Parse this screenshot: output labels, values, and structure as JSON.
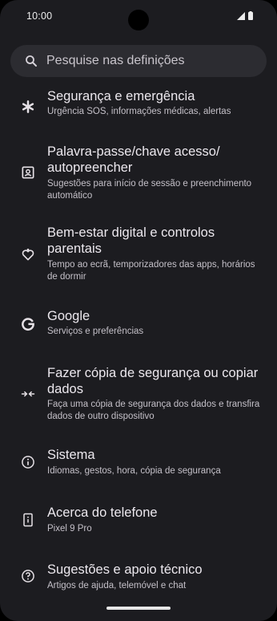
{
  "status_bar": {
    "time": "10:00"
  },
  "search": {
    "placeholder": "Pesquise nas definições"
  },
  "items": [
    {
      "title": "Segurança e emergência",
      "subtitle": "Urgência SOS, informações médicas, alertas",
      "icon": "asterisk-icon"
    },
    {
      "title": "Palavra-passe/chave acesso/ autopreencher",
      "subtitle": "Sugestões para início de sessão e preenchimento automático",
      "icon": "account-box-icon"
    },
    {
      "title": "Bem-estar digital e controlos parentais",
      "subtitle": "Tempo ao ecrã, temporizadores das apps, horários de dormir",
      "icon": "heart-person-icon"
    },
    {
      "title": "Google",
      "subtitle": "Serviços e preferências",
      "icon": "google-icon"
    },
    {
      "title": "Fazer cópia de segurança ou copiar dados",
      "subtitle": "Faça uma cópia de segurança dos dados e transfira dados de outro dispositivo",
      "icon": "transfer-icon"
    },
    {
      "title": "Sistema",
      "subtitle": "Idiomas, gestos, hora, cópia de segurança",
      "icon": "info-icon"
    },
    {
      "title": "Acerca do telefone",
      "subtitle": "Pixel 9 Pro",
      "icon": "phone-info-icon"
    },
    {
      "title": "Sugestões e apoio técnico",
      "subtitle": "Artigos de ajuda, telemóvel e chat",
      "icon": "help-icon"
    }
  ]
}
